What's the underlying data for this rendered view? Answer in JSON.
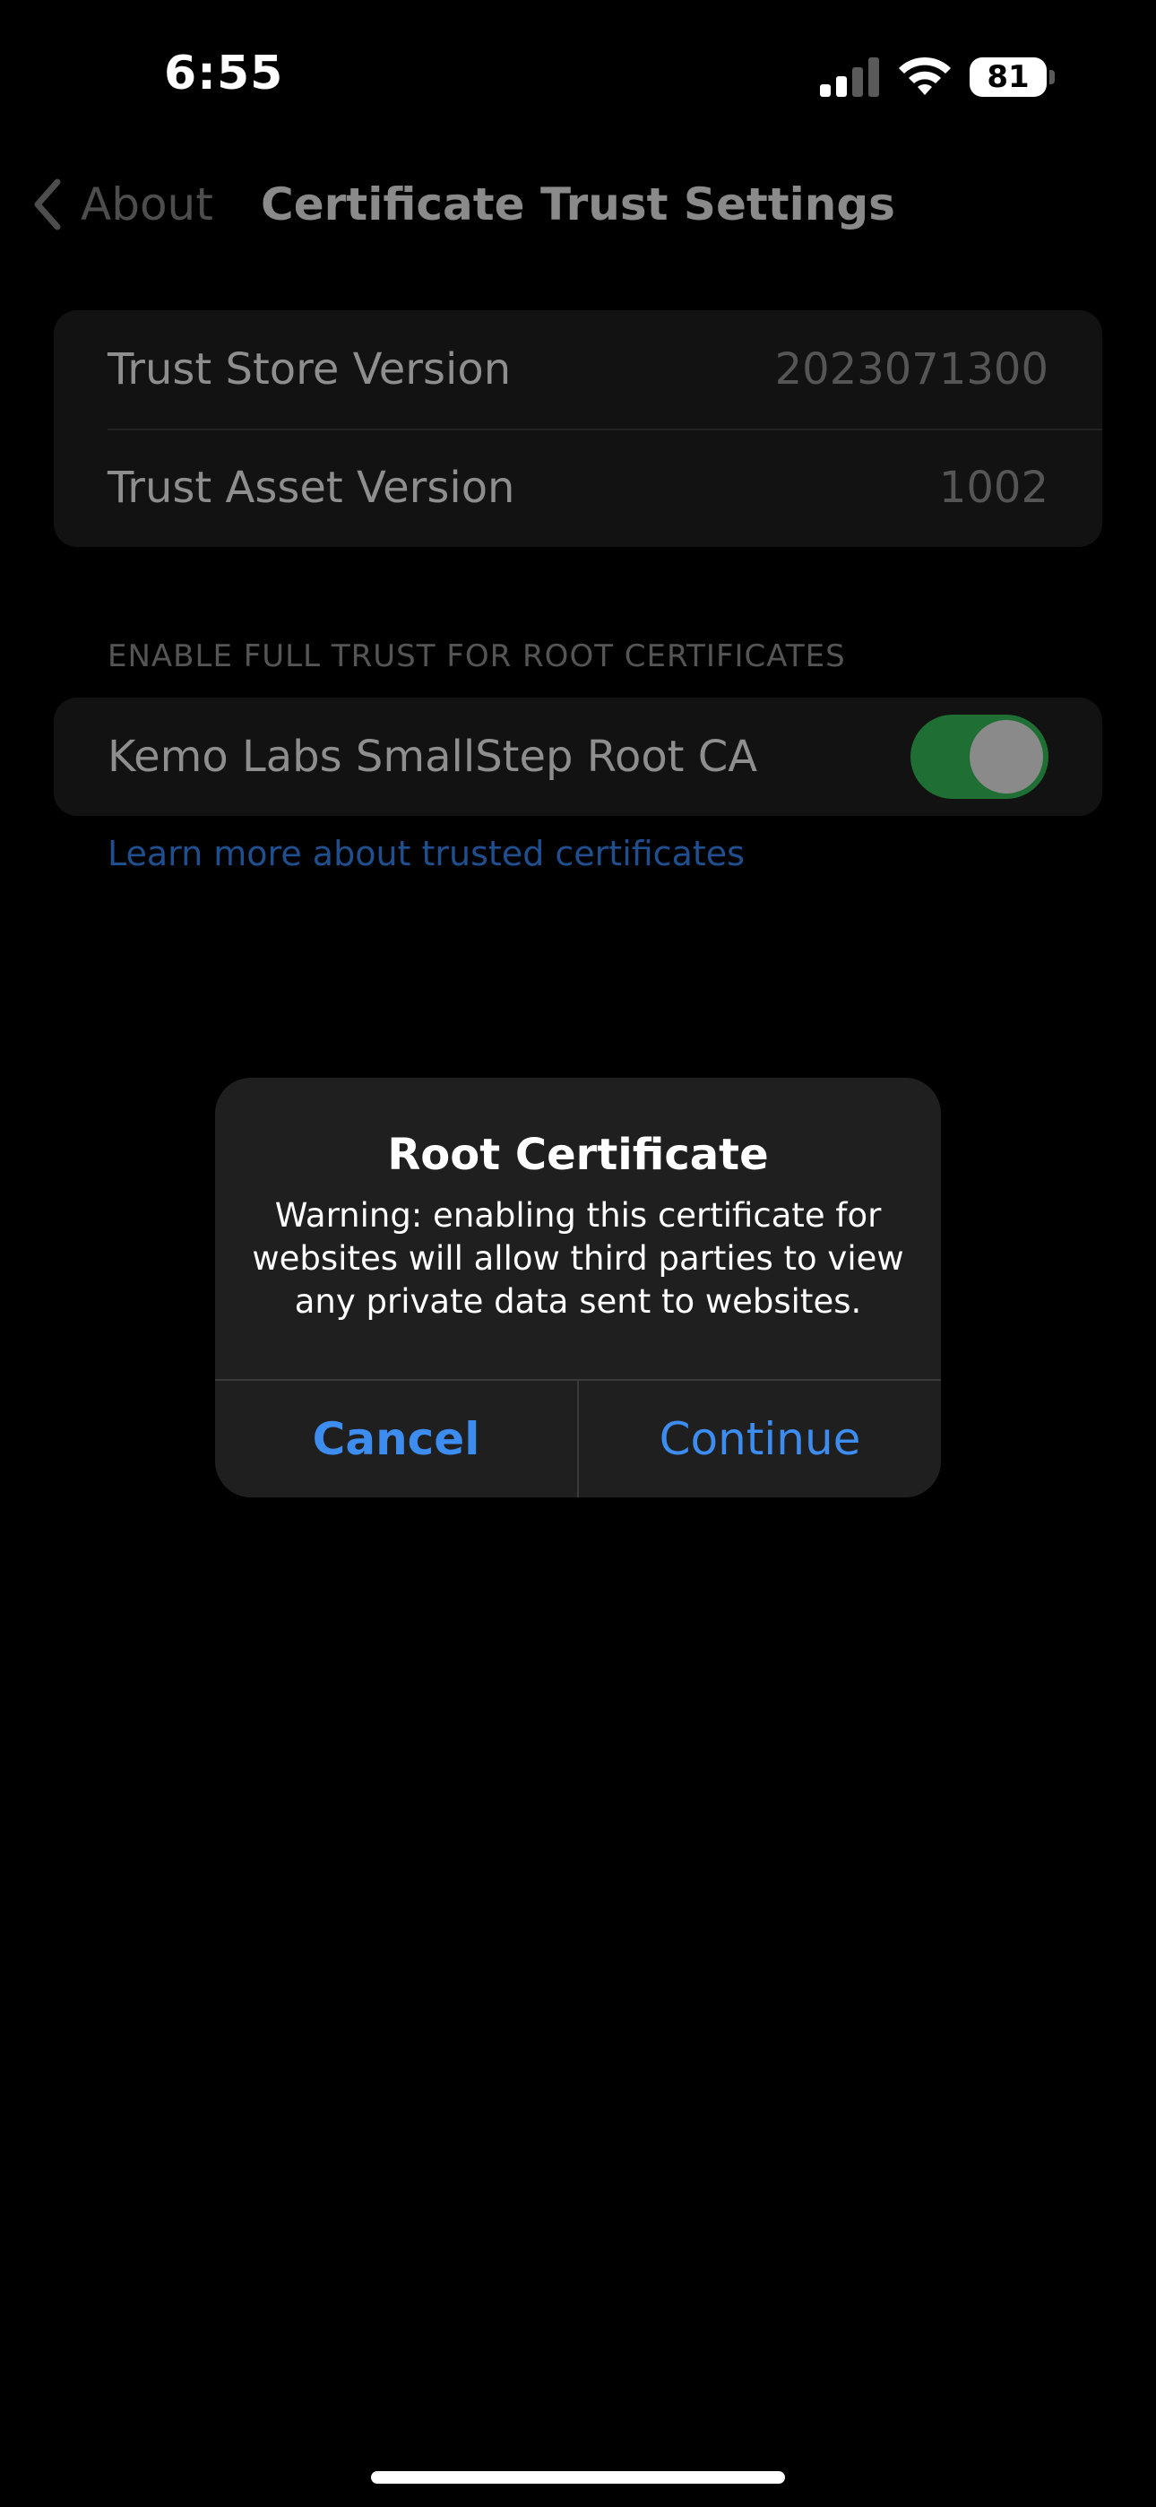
{
  "status_bar": {
    "time": "6:55",
    "battery_level": "81",
    "icons": [
      "signal-icon",
      "wifi-icon",
      "battery-icon"
    ]
  },
  "nav": {
    "back_label": "About",
    "back_icon": "chevron-left-icon",
    "title": "Certificate Trust Settings"
  },
  "versions": [
    {
      "label": "Trust Store Version",
      "value": "2023071300"
    },
    {
      "label": "Trust Asset Version",
      "value": "1002"
    }
  ],
  "trust_section": {
    "header": "ENABLE FULL TRUST FOR ROOT CERTIFICATES",
    "certificate_name": "Kemo Labs SmallStep Root CA",
    "toggle_on": true,
    "learn_more": "Learn more about trusted certificates"
  },
  "alert": {
    "title": "Root Certificate",
    "message": "Warning: enabling this certificate for websites will allow third parties to view any private data sent to websites.",
    "cancel_label": "Cancel",
    "continue_label": "Continue"
  },
  "colors": {
    "background": "#000000",
    "accent_blue": "#3d8cf0",
    "toggle_green": "#1f6e34",
    "alert_background": "#1f1f1f"
  }
}
